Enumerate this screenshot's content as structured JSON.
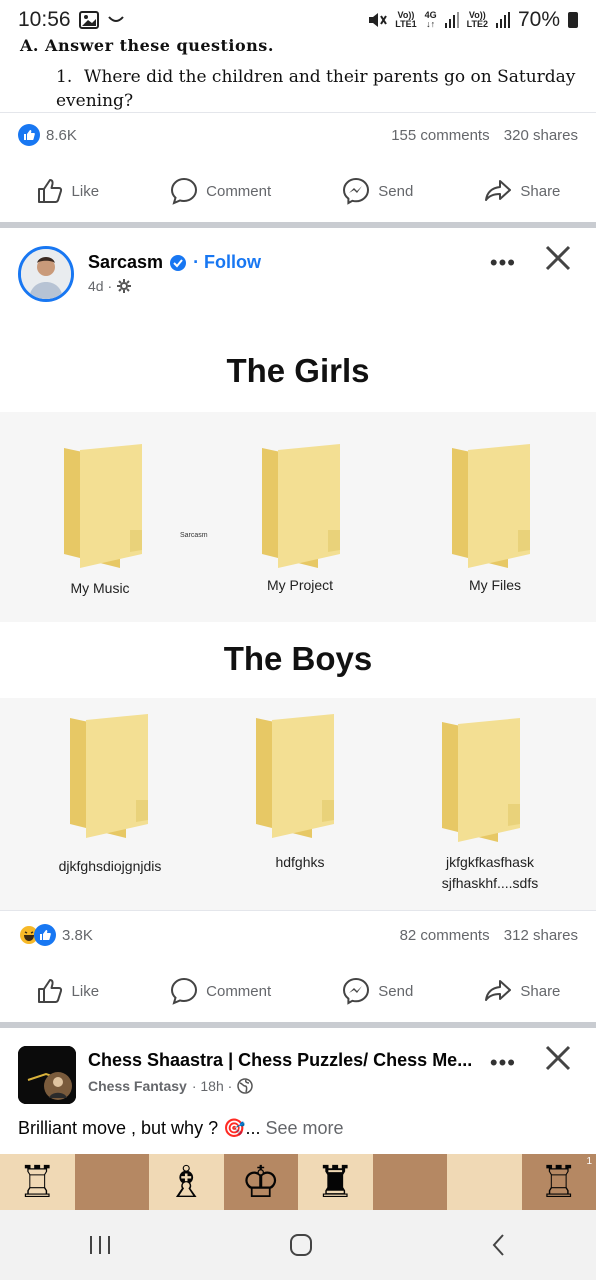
{
  "status_bar": {
    "time": "10:56",
    "net_top": "Vo))",
    "net_bottom": "LTE1",
    "net2_top": "4G",
    "net2_bottom": "↓↑",
    "net3_top": "Vo))",
    "net3_bottom": "LTE2",
    "battery": "70%"
  },
  "previous_post": {
    "heading": "A.  Answer these questions.",
    "question_number": "1.",
    "question_text": "Where did the children and their parents go on Saturday evening?",
    "reaction_count": "8.6K",
    "comments": "155 comments",
    "shares": "320 shares"
  },
  "actions": {
    "like": "Like",
    "comment": "Comment",
    "send": "Send",
    "share": "Share"
  },
  "sarcasm_post": {
    "page_name": "Sarcasm",
    "follow_label": "· Follow",
    "age": "4d ·",
    "meme": {
      "title_girls": "The Girls",
      "title_boys": "The Boys",
      "watermark": "Sarcasm",
      "girls_folders": [
        "My Music",
        "My Project",
        "My  Files"
      ],
      "boys_folders": [
        "djkfghsdiojgnjdis",
        "hdfghks",
        "jkfgkfkasfhask",
        "sjfhaskhf....sdfs"
      ]
    },
    "reaction_count": "3.8K",
    "comments": "82 comments",
    "shares": "312 shares"
  },
  "chess_post": {
    "page_name": "Chess Shaastra | Chess Puzzles/ Chess Me...",
    "author": "Chess Fantasy",
    "age": "· 18h ·",
    "text": "Brilliant move , but why ? 🎯...",
    "see_more": "See more",
    "board_corner": "1"
  },
  "colors": {
    "accent": "#1877f2",
    "folder": "#f2dc8a",
    "divider": "#c9ccd1"
  }
}
